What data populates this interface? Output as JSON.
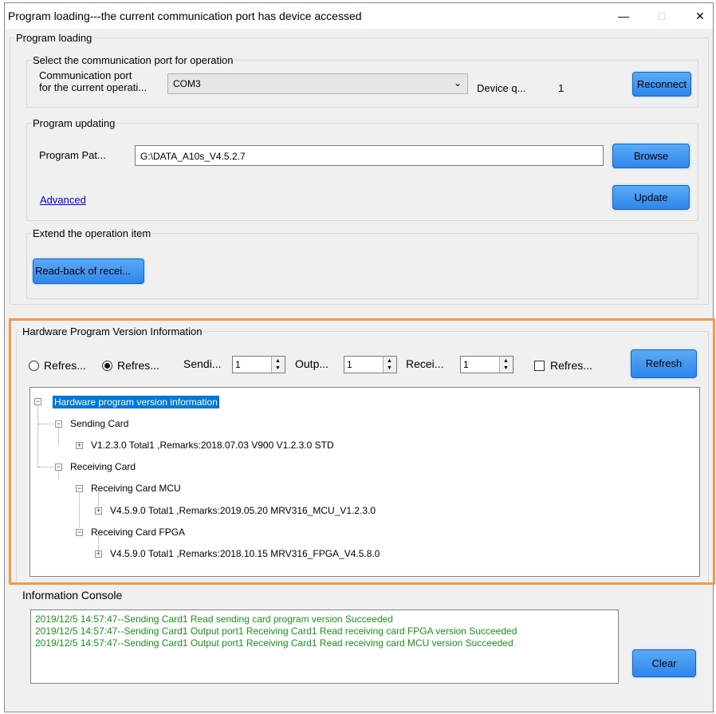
{
  "window": {
    "title": "Program loading---the current communication port has device accessed",
    "minimize": "—",
    "maximize": "□",
    "close": "✕"
  },
  "program_loading": {
    "group_label": "Program loading",
    "port_section": {
      "label": "Select the communication port for operation",
      "port_label_line1": "Communication port",
      "port_label_line2": "for the current operati...",
      "port_value": "COM3",
      "device_qty_label": "Device q...",
      "device_qty_value": "1",
      "reconnect_label": "Reconnect"
    },
    "updating": {
      "label": "Program updating",
      "path_label": "Program Pat...",
      "path_value": "G:\\DATA_A10s_V4.5.2.7",
      "browse_label": "Browse",
      "advanced_link": "Advanced",
      "update_label": "Update"
    },
    "extend": {
      "label": "Extend the operation item",
      "readback_label": "Read-back of recei..."
    }
  },
  "hardware": {
    "label": "Hardware Program Version Information",
    "radio1_label": "Refres...",
    "radio2_label": "Refres...",
    "sending_label": "Sendi...",
    "sending_value": "1",
    "output_label": "Outp...",
    "output_value": "1",
    "receiving_label": "Recei...",
    "receiving_value": "1",
    "checkbox_label": "Refres...",
    "refresh_button": "Refresh",
    "tree": {
      "root": "Hardware program version information",
      "sending_card": "Sending Card",
      "sending_version": "V1.2.3.0 Total1 ,Remarks:2018.07.03 V900 V1.2.3.0 STD",
      "receiving_card": "Receiving Card",
      "mcu": "Receiving Card MCU",
      "mcu_version": "V4.5.9.0 Total1 ,Remarks:2019.05.20 MRV316_MCU_V1.2.3.0",
      "fpga": "Receiving Card FPGA",
      "fpga_version": "V4.5.9.0 Total1 ,Remarks:2018.10.15 MRV316_FPGA_V4.5.8.0"
    }
  },
  "console": {
    "label": "Information Console",
    "lines": [
      "2019/12/5 14:57:47--Sending Card1 Read sending card program version Succeeded",
      "2019/12/5 14:57:47--Sending Card1 Output port1 Receiving Card1 Read receiving card FPGA version Succeeded",
      "2019/12/5 14:57:47--Sending Card1 Output port1 Receiving Card1 Read receiving card MCU version Succeeded"
    ],
    "clear_label": "Clear"
  },
  "colors": {
    "accent": "#2f86ec",
    "highlight_border": "#f39a4a",
    "console_text": "#18981a",
    "tree_selection": "#0078d7"
  }
}
